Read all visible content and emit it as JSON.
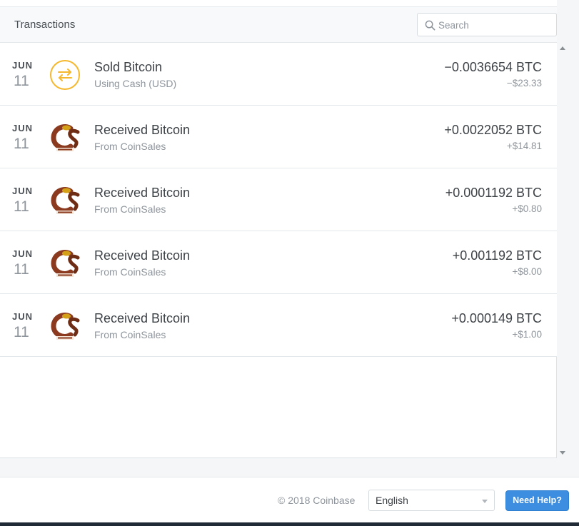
{
  "header": {
    "title": "Transactions",
    "search_placeholder": "Search"
  },
  "transactions": [
    {
      "month": "JUN",
      "day": "11",
      "title": "Sold Bitcoin",
      "subtitle": "Using Cash (USD)",
      "amount": "−0.0036654 BTC",
      "fiat": "−$23.33",
      "icon": "exchange-icon"
    },
    {
      "month": "JUN",
      "day": "11",
      "title": "Received Bitcoin",
      "subtitle": "From CoinSales",
      "amount": "+0.0022052 BTC",
      "fiat": "+$14.81",
      "icon": "coinsales-logo"
    },
    {
      "month": "JUN",
      "day": "11",
      "title": "Received Bitcoin",
      "subtitle": "From CoinSales",
      "amount": "+0.0001192 BTC",
      "fiat": "+$0.80",
      "icon": "coinsales-logo"
    },
    {
      "month": "JUN",
      "day": "11",
      "title": "Received Bitcoin",
      "subtitle": "From CoinSales",
      "amount": "+0.001192 BTC",
      "fiat": "+$8.00",
      "icon": "coinsales-logo"
    },
    {
      "month": "JUN",
      "day": "11",
      "title": "Received Bitcoin",
      "subtitle": "From CoinSales",
      "amount": "+0.000149 BTC",
      "fiat": "+$1.00",
      "icon": "coinsales-logo"
    }
  ],
  "footer": {
    "copyright": "© 2018 Coinbase",
    "language": "English",
    "help_label": "Need Help?"
  },
  "colors": {
    "accent": "#3d8ee0",
    "sold_icon": "#f5b82e",
    "logo_brown": "#8b3a1f",
    "logo_gold": "#d4a017"
  }
}
